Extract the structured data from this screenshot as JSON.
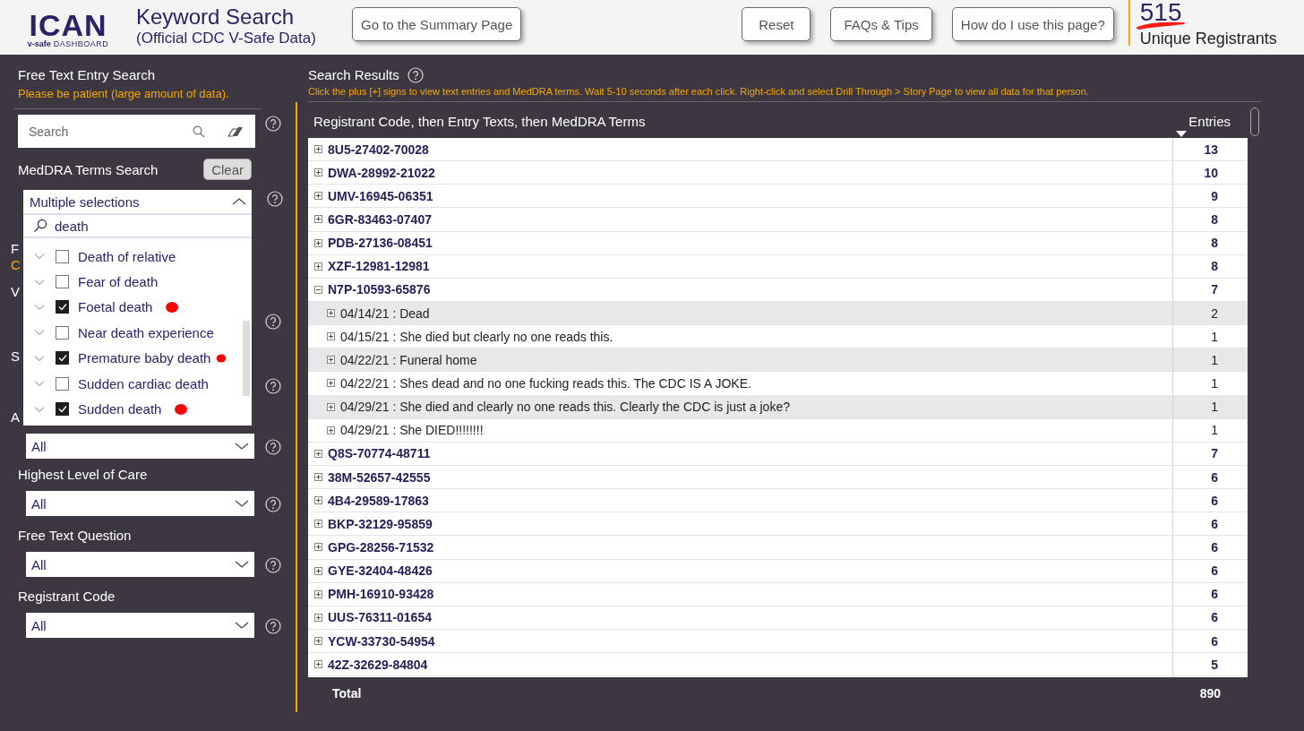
{
  "header": {
    "logo": {
      "title": "ICAN",
      "tagline_bold": "v-safe",
      "tagline": "DASHBOARD"
    },
    "title": "Keyword Search",
    "subtitle": "(Official CDC V-Safe Data)",
    "summary_button": "Go to the Summary Page",
    "tool_buttons": [
      "Reset",
      "FAQs & Tips",
      "How do I use this page?"
    ],
    "registrants": {
      "count": "515",
      "label": "Unique Registrants"
    }
  },
  "filters": {
    "free_text": {
      "title": "Free Text Entry Search",
      "note": "Please be patient (large amount of data).",
      "search": {
        "placeholder": "Search"
      }
    },
    "meddra": {
      "title": "MedDRA Terms Search",
      "clear_button": "Clear",
      "value": "Multiple selections",
      "expanded": true,
      "search_text": "death",
      "options": [
        {
          "label": "Death of relative",
          "checked": false
        },
        {
          "label": "Fear of death",
          "checked": false
        },
        {
          "label": "Foetal death",
          "checked": true
        },
        {
          "label": "Near death experience",
          "checked": false
        },
        {
          "label": "Premature baby death",
          "checked": true
        },
        {
          "label": "Sudden cardiac death",
          "checked": false
        },
        {
          "label": "Sudden death",
          "checked": true
        }
      ]
    },
    "sections": [
      {
        "kind": "note",
        "label": "F",
        "note": "C"
      },
      {
        "kind": "covered",
        "label": "V"
      },
      {
        "kind": "covered",
        "label": "S"
      },
      {
        "kind": "dropdown",
        "label": "A",
        "value": "All"
      },
      {
        "kind": "dropdown",
        "label": "Highest Level of Care",
        "value": "All"
      },
      {
        "kind": "dropdown",
        "label": "Free Text Question",
        "value": "All"
      },
      {
        "kind": "dropdown",
        "label": "Registrant Code",
        "value": "All"
      }
    ]
  },
  "results": {
    "title": "Search Results",
    "instructions": "Click the plus [+] signs to view text entries and MedDRA terms. Wait 5-10 seconds after each click. Right-click and select Drill Through > Story Page to view all data for that person.",
    "columns": [
      "Registrant Code, then Entry Texts, then MedDRA Terms",
      "Entries"
    ],
    "rows": [
      {
        "code": "8U5-27402-70028",
        "entries": "13",
        "expanded": false
      },
      {
        "code": "DWA-28992-21022",
        "entries": "10",
        "expanded": false
      },
      {
        "code": "UMV-16945-06351",
        "entries": "9",
        "expanded": false
      },
      {
        "code": "6GR-83463-07407",
        "entries": "8",
        "expanded": false
      },
      {
        "code": "PDB-27136-08451",
        "entries": "8",
        "expanded": false
      },
      {
        "code": "XZF-12981-12981",
        "entries": "8",
        "expanded": false
      },
      {
        "code": "N7P-10593-65876",
        "entries": "7",
        "expanded": true,
        "children": [
          {
            "text": "04/14/21 : Dead",
            "entries": "2"
          },
          {
            "text": "04/15/21 : She died but clearly no one reads this.",
            "entries": "1"
          },
          {
            "text": "04/22/21 : Funeral home",
            "entries": "1"
          },
          {
            "text": "04/22/21 : Shes dead and no one fucking reads this. The CDC IS A JOKE.",
            "entries": "1"
          },
          {
            "text": "04/29/21 : She died and clearly no one reads this. Clearly the CDC is just a joke?",
            "entries": "1"
          },
          {
            "text": "04/29/21 : She DIED!!!!!!!!",
            "entries": "1"
          }
        ]
      },
      {
        "code": "Q8S-70774-48711",
        "entries": "7",
        "expanded": false
      },
      {
        "code": "38M-52657-42555",
        "entries": "6",
        "expanded": false
      },
      {
        "code": "4B4-29589-17863",
        "entries": "6",
        "expanded": false
      },
      {
        "code": "BKP-32129-95859",
        "entries": "6",
        "expanded": false
      },
      {
        "code": "GPG-28256-71532",
        "entries": "6",
        "expanded": false
      },
      {
        "code": "GYE-32404-48426",
        "entries": "6",
        "expanded": false
      },
      {
        "code": "PMH-16910-93428",
        "entries": "6",
        "expanded": false
      },
      {
        "code": "UUS-76311-01654",
        "entries": "6",
        "expanded": false
      },
      {
        "code": "YCW-33730-54954",
        "entries": "6",
        "expanded": false
      },
      {
        "code": "42Z-32629-84804",
        "entries": "5",
        "expanded": false
      }
    ],
    "total": {
      "label": "Total",
      "value": "890"
    }
  }
}
